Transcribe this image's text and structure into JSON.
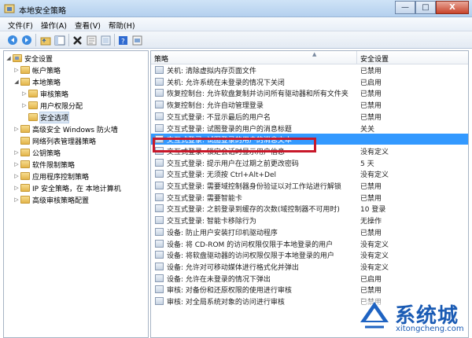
{
  "window": {
    "title": "本地安全策略",
    "minimize": "—",
    "maximize": "□",
    "close": "X"
  },
  "menu": [
    "文件(F)",
    "操作(A)",
    "查看(V)",
    "帮助(H)"
  ],
  "toolbar_icons": [
    "back-arrow-icon",
    "forward-arrow-icon",
    "up-folder-icon",
    "show-hide-tree-icon",
    "delete-icon",
    "properties-icon",
    "export-list-icon",
    "help-icon",
    "view-icon"
  ],
  "tree": [
    {
      "label": "安全设置",
      "arrow": "◢",
      "level": 0,
      "icon": "security-settings-icon"
    },
    {
      "label": "帐户策略",
      "arrow": "▷",
      "level": 1,
      "icon": "folder-icon"
    },
    {
      "label": "本地策略",
      "arrow": "◢",
      "level": 1,
      "icon": "folder-icon"
    },
    {
      "label": "审核策略",
      "arrow": "▷",
      "level": 2,
      "icon": "folder-icon"
    },
    {
      "label": "用户权限分配",
      "arrow": "▷",
      "level": 2,
      "icon": "folder-icon"
    },
    {
      "label": "安全选项",
      "arrow": "",
      "level": 2,
      "icon": "folder-icon",
      "selected": true
    },
    {
      "label": "高级安全 Windows 防火墙",
      "arrow": "▷",
      "level": 1,
      "icon": "firewall-icon"
    },
    {
      "label": "网络列表管理器策略",
      "arrow": "",
      "level": 1,
      "icon": "folder-icon"
    },
    {
      "label": "公钥策略",
      "arrow": "▷",
      "level": 1,
      "icon": "folder-icon"
    },
    {
      "label": "软件限制策略",
      "arrow": "▷",
      "level": 1,
      "icon": "folder-icon"
    },
    {
      "label": "应用程序控制策略",
      "arrow": "▷",
      "level": 1,
      "icon": "folder-icon"
    },
    {
      "label": "IP 安全策略，在 本地计算机",
      "arrow": "▷",
      "level": 1,
      "icon": "ip-security-icon"
    },
    {
      "label": "高级审核策略配置",
      "arrow": "▷",
      "level": 1,
      "icon": "folder-icon"
    }
  ],
  "columns": {
    "policy": "策略",
    "setting": "安全设置"
  },
  "rows": [
    {
      "policy": "关机: 清除虚拟内存页面文件",
      "setting": "已禁用"
    },
    {
      "policy": "关机: 允许系统在未登录的情况下关闭",
      "setting": "已启用"
    },
    {
      "policy": "恢复控制台: 允许软盘复制并访问所有驱动器和所有文件夹",
      "setting": "已禁用"
    },
    {
      "policy": "恢复控制台: 允许自动管理登录",
      "setting": "已禁用"
    },
    {
      "policy": "交互式登录: 不显示最后的用户名",
      "setting": "已禁用"
    },
    {
      "policy": "交互式登录: 试图登录的用户的消息标题",
      "setting": "关关"
    },
    {
      "policy": "交互式登录: 试图登录的用户的消息文本",
      "setting": "",
      "selected": true
    },
    {
      "policy": "交互式登录: 锁定会话时显示用户信息",
      "setting": "没有定义"
    },
    {
      "policy": "交互式登录: 提示用户在过期之前更改密码",
      "setting": "5 天"
    },
    {
      "policy": "交互式登录: 无须按 Ctrl+Alt+Del",
      "setting": "没有定义"
    },
    {
      "policy": "交互式登录: 需要域控制器身份验证以对工作站进行解锁",
      "setting": "已禁用"
    },
    {
      "policy": "交互式登录: 需要智能卡",
      "setting": "已禁用"
    },
    {
      "policy": "交互式登录: 之前登录到缓存的次数(域控制器不可用时)",
      "setting": "10 登录"
    },
    {
      "policy": "交互式登录: 智能卡移除行为",
      "setting": "无操作"
    },
    {
      "policy": "设备: 防止用户安装打印机驱动程序",
      "setting": "已禁用"
    },
    {
      "policy": "设备: 将 CD-ROM 的访问权限仅限于本地登录的用户",
      "setting": "没有定义"
    },
    {
      "policy": "设备: 将软盘驱动器的访问权限仅限于本地登录的用户",
      "setting": "没有定义"
    },
    {
      "policy": "设备: 允许对可移动媒体进行格式化并弹出",
      "setting": "没有定义"
    },
    {
      "policy": "设备: 允许在未登录的情况下弹出",
      "setting": "已启用"
    },
    {
      "policy": "审核: 对备份和还原权限的使用进行审核",
      "setting": "已禁用"
    },
    {
      "policy": "审核: 对全局系统对象的访问进行审核",
      "setting": "已禁用"
    }
  ],
  "watermark": {
    "brand": "系统城",
    "url": "xitongcheng.com"
  },
  "colors": {
    "selection": "#3399ff",
    "highlight_box": "#c8182a",
    "watermark": "#1a5bb4"
  }
}
